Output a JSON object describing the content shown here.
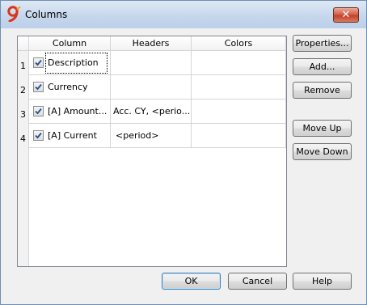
{
  "window": {
    "title": "Columns",
    "close_label": "✕"
  },
  "grid": {
    "headers": [
      "Column",
      "Headers",
      "Colors"
    ],
    "rows": [
      {
        "num": "1",
        "checked": true,
        "column": "Description",
        "headers": "",
        "colors": ""
      },
      {
        "num": "2",
        "checked": true,
        "column": "Currency",
        "headers": "",
        "colors": ""
      },
      {
        "num": "3",
        "checked": true,
        "column": "[A] Amount...",
        "headers": "Acc. CY, <perio...",
        "colors": ""
      },
      {
        "num": "4",
        "checked": true,
        "column": "[A] Current",
        "headers": "<period>",
        "colors": ""
      }
    ]
  },
  "side_buttons": {
    "properties": "Properties...",
    "add": "Add...",
    "remove": "Remove",
    "move_up": "Move Up",
    "move_down": "Move Down"
  },
  "footer_buttons": {
    "ok": "OK",
    "cancel": "Cancel",
    "help": "Help"
  },
  "colors": {
    "accent": "#3c7fb1",
    "app_icon_red": "#d9361c",
    "app_icon_orange": "#f3a21a",
    "checkmark": "#1f4f8f"
  }
}
